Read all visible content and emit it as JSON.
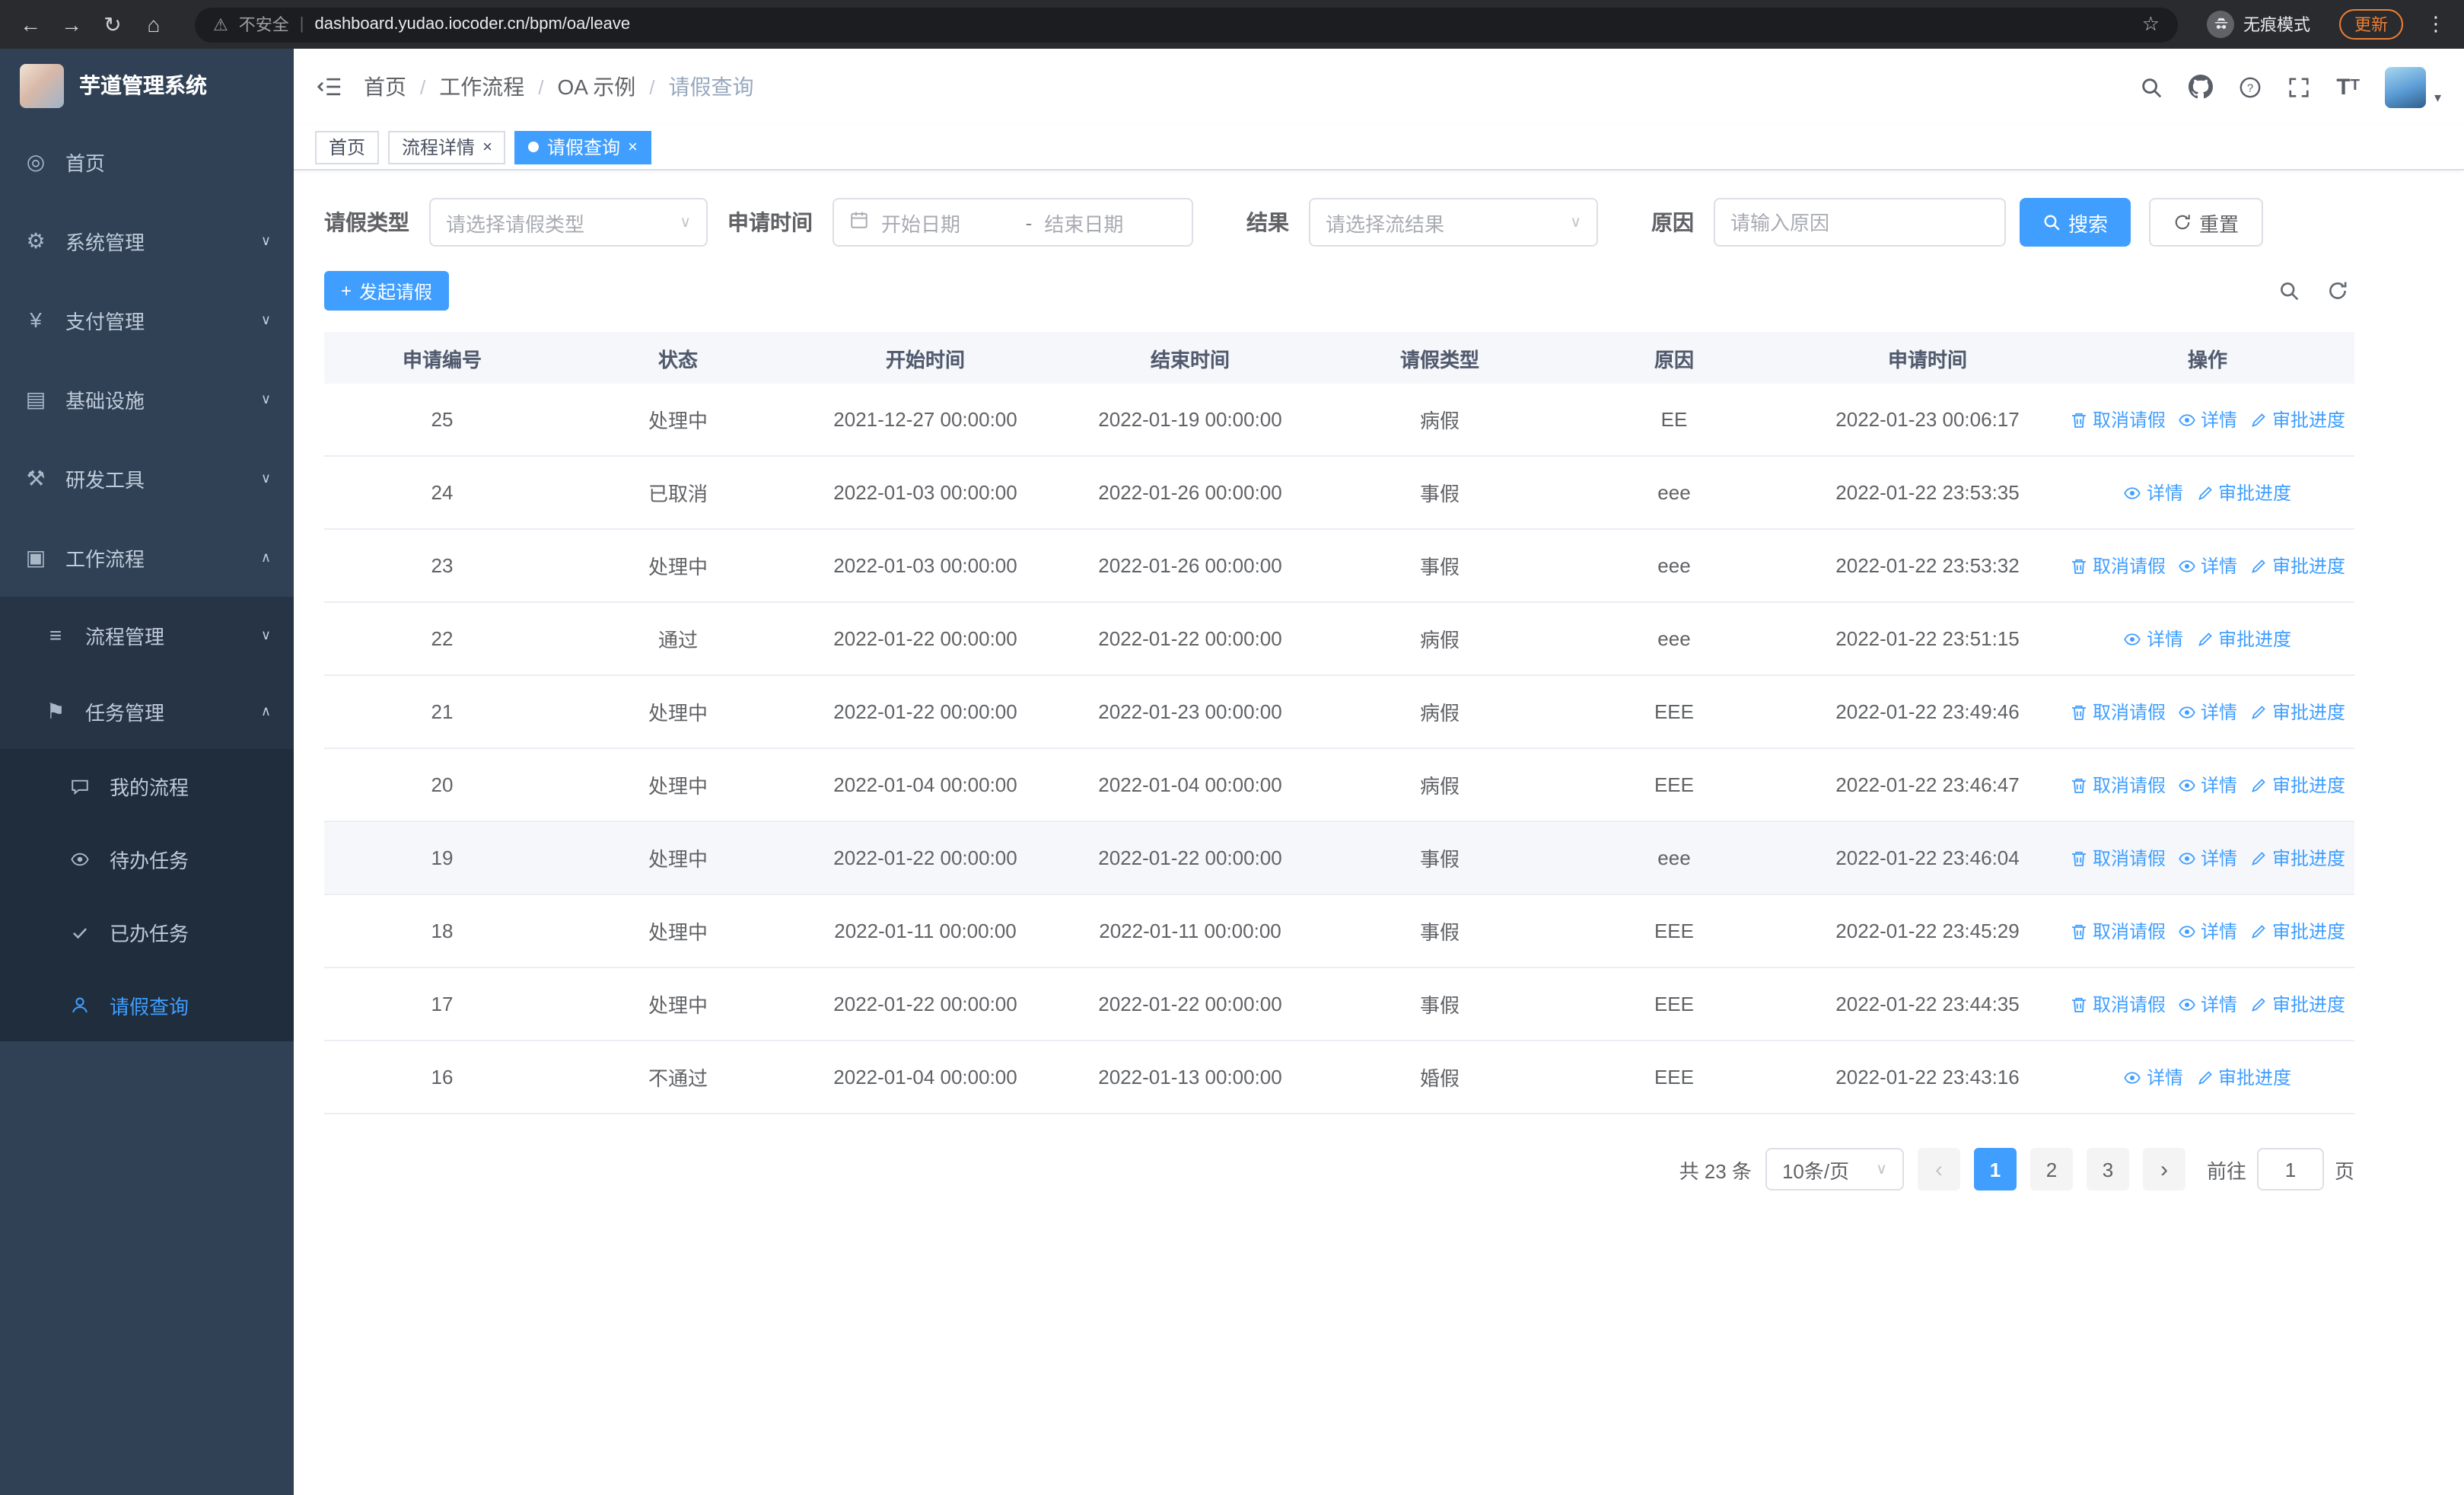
{
  "colors": {
    "accent": "#409eff",
    "sidebar_bg": "#304156",
    "sidebar_sub_bg": "#1f2d3d"
  },
  "browser": {
    "security_label": "不安全",
    "url": "dashboard.yudao.iocoder.cn/bpm/oa/leave",
    "incognito_label": "无痕模式",
    "update_label": "更新"
  },
  "icons": {
    "dashboard": "◎",
    "settings": "⚙",
    "payment": "¥",
    "infrastructure": "▤",
    "dev_tools": "⚒",
    "workflow": "▣",
    "process_mgmt": "≡",
    "task_mgmt": "⚑"
  },
  "sidebar": {
    "logo_title": "芋道管理系统",
    "items": [
      {
        "label": "首页"
      },
      {
        "label": "系统管理"
      },
      {
        "label": "支付管理"
      },
      {
        "label": "基础设施"
      },
      {
        "label": "研发工具"
      },
      {
        "label": "工作流程"
      },
      {
        "label": "流程管理"
      },
      {
        "label": "任务管理"
      },
      {
        "label": "我的流程"
      },
      {
        "label": "待办任务"
      },
      {
        "label": "已办任务"
      },
      {
        "label": "请假查询"
      }
    ]
  },
  "breadcrumb": {
    "items": [
      "首页",
      "工作流程",
      "OA 示例",
      "请假查询"
    ]
  },
  "tabs": [
    {
      "label": "首页",
      "active": false,
      "closable": false
    },
    {
      "label": "流程详情",
      "active": false,
      "closable": true
    },
    {
      "label": "请假查询",
      "active": true,
      "closable": true
    }
  ],
  "filters": {
    "leave_type_label": "请假类型",
    "leave_type_placeholder": "请选择请假类型",
    "apply_time_label": "申请时间",
    "start_date_placeholder": "开始日期",
    "range_separator": "-",
    "end_date_placeholder": "结束日期",
    "result_label": "结果",
    "result_placeholder": "请选择流结果",
    "reason_label": "原因",
    "reason_placeholder": "请输入原因",
    "search_button": "搜索",
    "reset_button": "重置"
  },
  "toolbar": {
    "create_button": "发起请假"
  },
  "table": {
    "columns": [
      "申请编号",
      "状态",
      "开始时间",
      "结束时间",
      "请假类型",
      "原因",
      "申请时间",
      "操作"
    ],
    "action_labels": {
      "cancel": "取消请假",
      "detail": "详情",
      "progress": "审批进度"
    },
    "rows": [
      {
        "id": "25",
        "status": "处理中",
        "start": "2021-12-27 00:00:00",
        "end": "2022-01-19 00:00:00",
        "type": "病假",
        "reason": "EE",
        "applied": "2022-01-23 00:06:17",
        "actions": [
          "cancel",
          "detail",
          "progress"
        ]
      },
      {
        "id": "24",
        "status": "已取消",
        "start": "2022-01-03 00:00:00",
        "end": "2022-01-26 00:00:00",
        "type": "事假",
        "reason": "eee",
        "applied": "2022-01-22 23:53:35",
        "actions": [
          "detail",
          "progress"
        ]
      },
      {
        "id": "23",
        "status": "处理中",
        "start": "2022-01-03 00:00:00",
        "end": "2022-01-26 00:00:00",
        "type": "事假",
        "reason": "eee",
        "applied": "2022-01-22 23:53:32",
        "actions": [
          "cancel",
          "detail",
          "progress"
        ]
      },
      {
        "id": "22",
        "status": "通过",
        "start": "2022-01-22 00:00:00",
        "end": "2022-01-22 00:00:00",
        "type": "病假",
        "reason": "eee",
        "applied": "2022-01-22 23:51:15",
        "actions": [
          "detail",
          "progress"
        ]
      },
      {
        "id": "21",
        "status": "处理中",
        "start": "2022-01-22 00:00:00",
        "end": "2022-01-23 00:00:00",
        "type": "病假",
        "reason": "EEE",
        "applied": "2022-01-22 23:49:46",
        "actions": [
          "cancel",
          "detail",
          "progress"
        ]
      },
      {
        "id": "20",
        "status": "处理中",
        "start": "2022-01-04 00:00:00",
        "end": "2022-01-04 00:00:00",
        "type": "病假",
        "reason": "EEE",
        "applied": "2022-01-22 23:46:47",
        "actions": [
          "cancel",
          "detail",
          "progress"
        ]
      },
      {
        "id": "19",
        "status": "处理中",
        "start": "2022-01-22 00:00:00",
        "end": "2022-01-22 00:00:00",
        "type": "事假",
        "reason": "eee",
        "applied": "2022-01-22 23:46:04",
        "actions": [
          "cancel",
          "detail",
          "progress"
        ],
        "highlighted": true
      },
      {
        "id": "18",
        "status": "处理中",
        "start": "2022-01-11 00:00:00",
        "end": "2022-01-11 00:00:00",
        "type": "事假",
        "reason": "EEE",
        "applied": "2022-01-22 23:45:29",
        "actions": [
          "cancel",
          "detail",
          "progress"
        ]
      },
      {
        "id": "17",
        "status": "处理中",
        "start": "2022-01-22 00:00:00",
        "end": "2022-01-22 00:00:00",
        "type": "事假",
        "reason": "EEE",
        "applied": "2022-01-22 23:44:35",
        "actions": [
          "cancel",
          "detail",
          "progress"
        ]
      },
      {
        "id": "16",
        "status": "不通过",
        "start": "2022-01-04 00:00:00",
        "end": "2022-01-13 00:00:00",
        "type": "婚假",
        "reason": "EEE",
        "applied": "2022-01-22 23:43:16",
        "actions": [
          "detail",
          "progress"
        ]
      }
    ]
  },
  "pagination": {
    "total": "共 23 条",
    "page_size": "10条/页",
    "pages": [
      "1",
      "2",
      "3"
    ],
    "active_page": "1",
    "goto_label": "前往",
    "goto_value": "1",
    "goto_suffix": "页"
  }
}
